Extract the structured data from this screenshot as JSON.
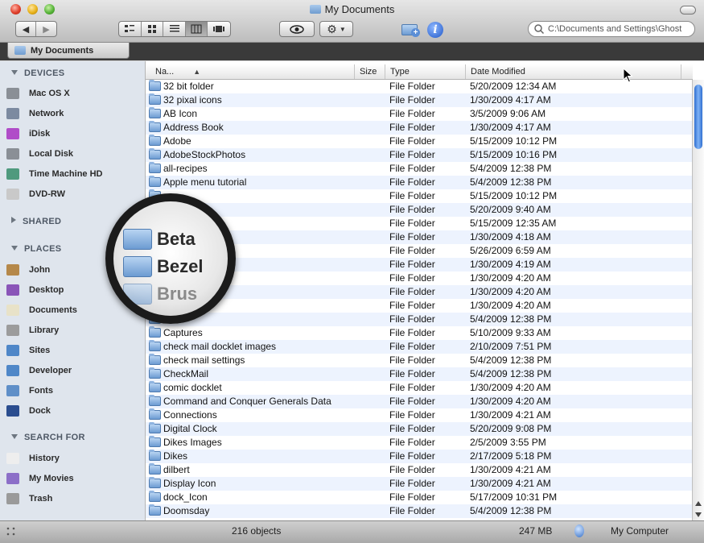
{
  "window": {
    "title": "My Documents"
  },
  "search": {
    "value": "C:\\Documents and Settings\\Ghost"
  },
  "tab": {
    "label": "My Documents"
  },
  "sidebar": {
    "devices_header": "DEVICES",
    "devices": [
      {
        "label": "Mac OS X",
        "icon": "harddisk-icon",
        "color": "#8a8f96"
      },
      {
        "label": "Network",
        "icon": "globe-icon",
        "color": "#7c8aa0"
      },
      {
        "label": "iDisk",
        "icon": "idisk-icon",
        "color": "#b04cc8"
      },
      {
        "label": "Local Disk",
        "icon": "harddisk-icon",
        "color": "#8a8f96"
      },
      {
        "label": "Time Machine HD",
        "icon": "time-machine-icon",
        "color": "#4f9a7e"
      },
      {
        "label": "DVD-RW",
        "icon": "dvd-icon",
        "color": "#c9c9c9"
      }
    ],
    "shared_header": "SHARED",
    "places_header": "PLACES",
    "places": [
      {
        "label": "John",
        "icon": "home-icon",
        "color": "#b5884a"
      },
      {
        "label": "Desktop",
        "icon": "desktop-icon",
        "color": "#8a55b8"
      },
      {
        "label": "Documents",
        "icon": "documents-icon",
        "color": "#e8e2c8"
      },
      {
        "label": "Library",
        "icon": "library-icon",
        "color": "#9c9c9c"
      },
      {
        "label": "Sites",
        "icon": "sites-icon",
        "color": "#4f87c8"
      },
      {
        "label": "Developer",
        "icon": "developer-icon",
        "color": "#4f87c8"
      },
      {
        "label": "Fonts",
        "icon": "fonts-icon",
        "color": "#5f8fc8"
      },
      {
        "label": "Dock",
        "icon": "dock-icon",
        "color": "#2a4d8f"
      }
    ],
    "search_header": "SEARCH FOR",
    "searches": [
      {
        "label": "History",
        "icon": "clock-icon",
        "color": "#eeeeee"
      },
      {
        "label": "My Movies",
        "icon": "smart-folder-icon",
        "color": "#8c6fc8"
      },
      {
        "label": "Trash",
        "icon": "trash-icon",
        "color": "#9a9a9a"
      }
    ]
  },
  "columns": {
    "name": "Na...",
    "size": "Size",
    "type": "Type",
    "date": "Date Modified"
  },
  "rows": [
    {
      "name": "32 bit folder",
      "type": "File Folder",
      "date": "5/20/2009 12:34 AM"
    },
    {
      "name": "32 pixal icons",
      "type": "File Folder",
      "date": "1/30/2009 4:17 AM"
    },
    {
      "name": "AB Icon",
      "type": "File Folder",
      "date": "3/5/2009 9:06 AM"
    },
    {
      "name": "Address Book",
      "type": "File Folder",
      "date": "1/30/2009 4:17 AM"
    },
    {
      "name": "Adobe",
      "type": "File Folder",
      "date": "5/15/2009 10:12 PM"
    },
    {
      "name": "AdobeStockPhotos",
      "type": "File Folder",
      "date": "5/15/2009 10:16 PM"
    },
    {
      "name": "all-recipes",
      "type": "File Folder",
      "date": "5/4/2009 12:38 PM"
    },
    {
      "name": "Apple menu tutorial",
      "type": "File Folder",
      "date": "5/4/2009 12:38 PM"
    },
    {
      "name": "",
      "type": "File Folder",
      "date": "5/15/2009 10:12 PM"
    },
    {
      "name": "rian",
      "type": "File Folder",
      "date": "5/20/2009 9:40 AM"
    },
    {
      "name": "",
      "type": "File Folder",
      "date": "5/15/2009 12:35 AM"
    },
    {
      "name": "al",
      "type": "File Folder",
      "date": "1/30/2009 4:18 AM"
    },
    {
      "name": "",
      "type": "File Folder",
      "date": "5/26/2009 6:59 AM"
    },
    {
      "name": "",
      "type": "File Folder",
      "date": "1/30/2009 4:19 AM"
    },
    {
      "name": "",
      "type": "File Folder",
      "date": "1/30/2009 4:20 AM"
    },
    {
      "name": "",
      "type": "File Folder",
      "date": "1/30/2009 4:20 AM"
    },
    {
      "name": "",
      "type": "File Folder",
      "date": "1/30/2009 4:20 AM"
    },
    {
      "name": "",
      "type": "File Folder",
      "date": "5/4/2009 12:38 PM"
    },
    {
      "name": "Captures",
      "type": "File Folder",
      "date": "5/10/2009 9:33 AM"
    },
    {
      "name": "check mail docklet images",
      "type": "File Folder",
      "date": "2/10/2009 7:51 PM"
    },
    {
      "name": "check mail settings",
      "type": "File Folder",
      "date": "5/4/2009 12:38 PM"
    },
    {
      "name": "CheckMail",
      "type": "File Folder",
      "date": "5/4/2009 12:38 PM"
    },
    {
      "name": "comic docklet",
      "type": "File Folder",
      "date": "1/30/2009 4:20 AM"
    },
    {
      "name": "Command and Conquer Generals Data",
      "type": "File Folder",
      "date": "1/30/2009 4:20 AM"
    },
    {
      "name": "Connections",
      "type": "File Folder",
      "date": "1/30/2009 4:21 AM"
    },
    {
      "name": "Digital Clock",
      "type": "File Folder",
      "date": "5/20/2009 9:08 PM"
    },
    {
      "name": "Dikes Images",
      "type": "File Folder",
      "date": "2/5/2009 3:55 PM"
    },
    {
      "name": "Dikes",
      "type": "File Folder",
      "date": "2/17/2009 5:18 PM"
    },
    {
      "name": "dilbert",
      "type": "File Folder",
      "date": "1/30/2009 4:21 AM"
    },
    {
      "name": "Display Icon",
      "type": "File Folder",
      "date": "1/30/2009 4:21 AM"
    },
    {
      "name": "dock_Icon",
      "type": "File Folder",
      "date": "5/17/2009 10:31 PM"
    },
    {
      "name": "Doomsday",
      "type": "File Folder",
      "date": "5/4/2009 12:38 PM"
    }
  ],
  "magnifier": {
    "items": [
      "Beta",
      "Bezel",
      "Brus"
    ]
  },
  "status": {
    "count": "216 objects",
    "free": "247 MB",
    "location": "My Computer"
  }
}
